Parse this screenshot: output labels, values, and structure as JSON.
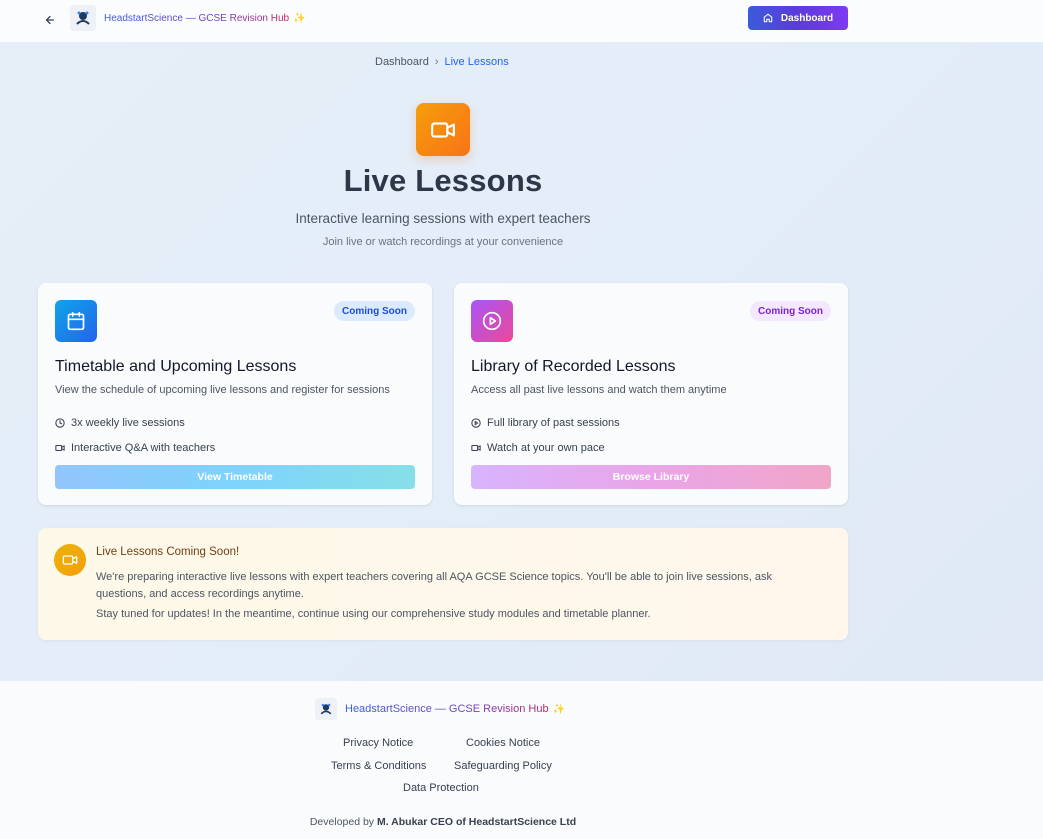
{
  "header": {
    "brand": "HeadstartScience — GCSE Revision Hub",
    "dashboard_label": "Dashboard"
  },
  "breadcrumb": {
    "home": "Dashboard",
    "current": "Live Lessons"
  },
  "hero": {
    "title": "Live Lessons",
    "subtitle": "Interactive learning sessions with expert teachers",
    "subtitle2": "Join live or watch recordings at your convenience"
  },
  "cards": [
    {
      "badge": "Coming Soon",
      "title": "Timetable and Upcoming Lessons",
      "description": "View the schedule of upcoming live lessons and register for sessions",
      "features": [
        "3x weekly live sessions",
        "Interactive Q&A with teachers"
      ],
      "button": "View Timetable"
    },
    {
      "badge": "Coming Soon",
      "title": "Library of Recorded Lessons",
      "description": "Access all past live lessons and watch them anytime",
      "features": [
        "Full library of past sessions",
        "Watch at your own pace"
      ],
      "button": "Browse Library"
    }
  ],
  "notice": {
    "title": "Live Lessons Coming Soon!",
    "body": "We're preparing interactive live lessons with expert teachers covering all AQA GCSE Science topics. You'll be able to join live sessions, ask questions, and access recordings anytime.",
    "body2": "Stay tuned for updates! In the meantime, continue using our comprehensive study modules and timetable planner."
  },
  "footer": {
    "brand": "HeadstartScience — GCSE Revision Hub",
    "links": [
      "Privacy Notice",
      "Cookies Notice",
      "Terms & Conditions",
      "Safeguarding Policy",
      "Data Protection"
    ],
    "developed_prefix": "Developed by",
    "developer": "M. Abukar CEO of HeadstartScience Ltd"
  },
  "colors": {
    "accent": "#3b5bdb",
    "hero_icon": "#f97316",
    "link": "#2563eb"
  },
  "icons": {
    "back": "arrow-left-icon",
    "dashboard": "home-icon",
    "hero": "video-camera-icon",
    "card1": "calendar-icon",
    "card2": "play-circle-icon",
    "feature_clock": "clock-icon",
    "feature_video": "video-icon"
  }
}
